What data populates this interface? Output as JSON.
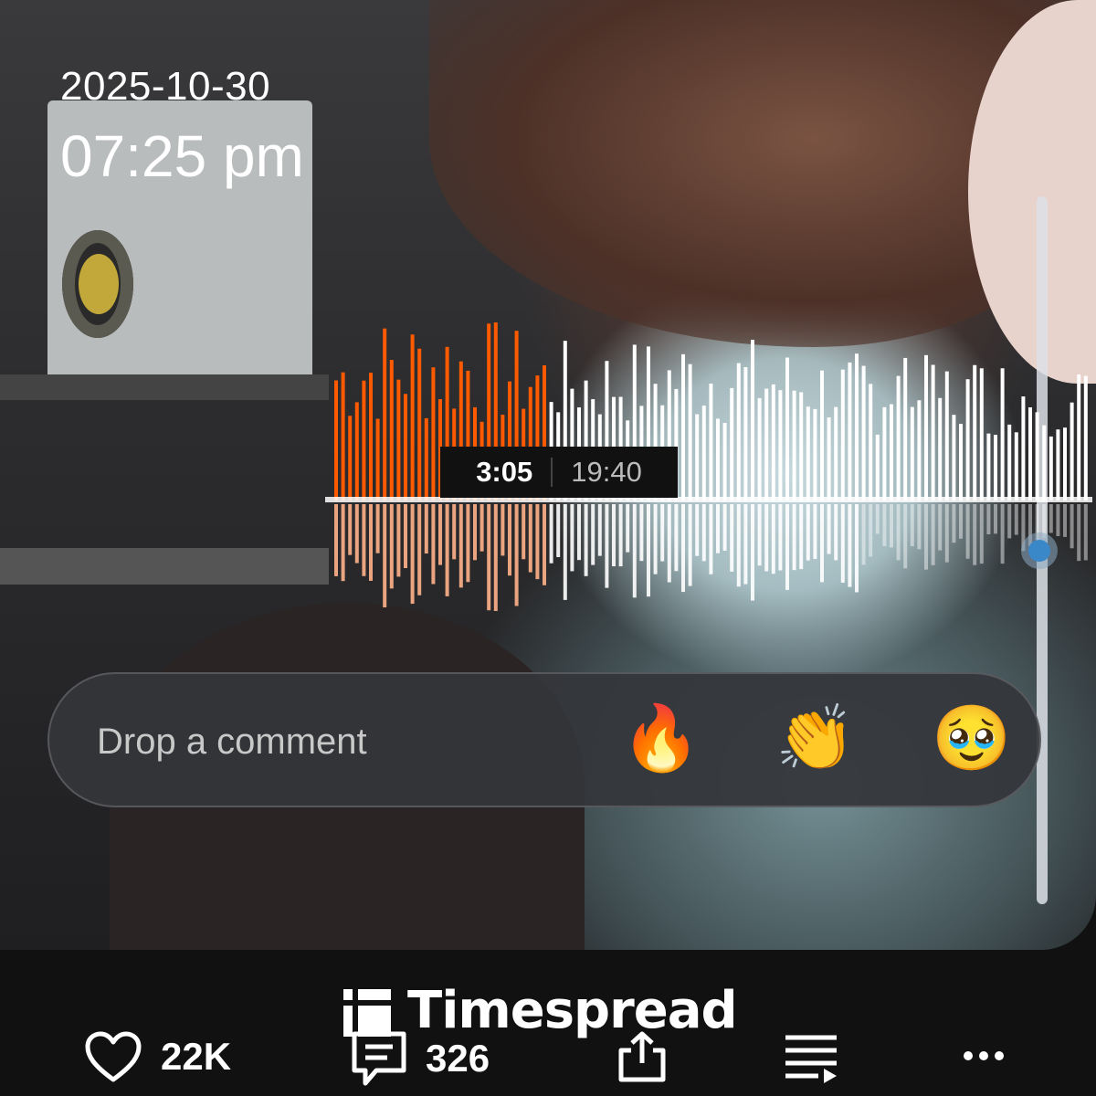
{
  "post": {
    "date": "2025-10-30",
    "time": "07:25 pm"
  },
  "player": {
    "current_time": "3:05",
    "duration": "19:40",
    "progress": 0.157,
    "colors": {
      "played": "#ff5a00",
      "played_reflection": "#ffb38a",
      "unplayed": "#ffffff"
    }
  },
  "comment_bar": {
    "placeholder": "Drop a comment",
    "reactions": [
      {
        "name": "fire",
        "glyph": "🔥"
      },
      {
        "name": "clap",
        "glyph": "👏"
      },
      {
        "name": "pleading-face",
        "glyph": "🥹"
      }
    ]
  },
  "brand": {
    "name": "Timespread"
  },
  "actions": {
    "likes": "22K",
    "comments": "326"
  },
  "icons": [
    "heart-icon",
    "comment-icon",
    "share-icon",
    "playlist-icon",
    "more-icon"
  ]
}
